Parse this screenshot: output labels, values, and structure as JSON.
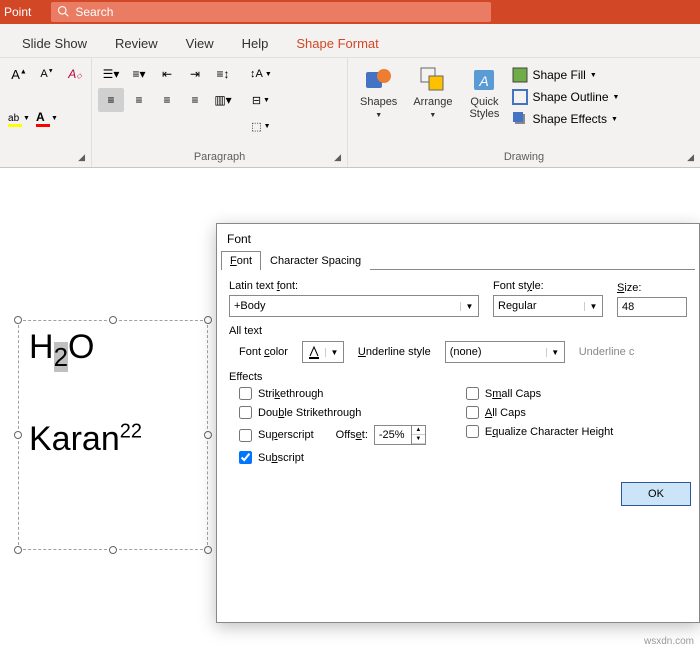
{
  "titlebar": {
    "app_name": "Point",
    "search_placeholder": "Search"
  },
  "tabs": {
    "slideshow": "Slide Show",
    "review": "Review",
    "view": "View",
    "help": "Help",
    "shapeformat": "Shape Format"
  },
  "ribbon": {
    "paragraph_label": "Paragraph",
    "drawing_label": "Drawing",
    "shapes": "Shapes",
    "arrange": "Arrange",
    "quick_styles": "Quick\nStyles",
    "shape_fill": "Shape Fill",
    "shape_outline": "Shape Outline",
    "shape_effects": "Shape Effects"
  },
  "canvas": {
    "text1_prefix": "H",
    "text1_sel": "2",
    "text1_suffix": "O",
    "text2_base": "Karan",
    "text2_sup": "22"
  },
  "dialog": {
    "title": "Font",
    "tab_font": "Font",
    "tab_spacing": "Character Spacing",
    "latin_label": "Latin text font:",
    "latin_value": "+Body",
    "style_label": "Font style:",
    "style_value": "Regular",
    "size_label": "Size:",
    "size_value": "48",
    "alltext": "All text",
    "fontcolor_label": "Font color",
    "underline_label": "Underline style",
    "underline_value": "(none)",
    "underlinec_label": "Underline c",
    "effects_label": "Effects",
    "strike": "Strikethrough",
    "dstrike": "Double Strikethrough",
    "superscript": "Superscript",
    "subscript": "Subscript",
    "offset_label": "Offset:",
    "offset_value": "-25%",
    "smallcaps": "Small Caps",
    "allcaps": "All Caps",
    "equalize": "Equalize Character Height",
    "ok": "OK"
  },
  "watermark": "wsxdn.com"
}
